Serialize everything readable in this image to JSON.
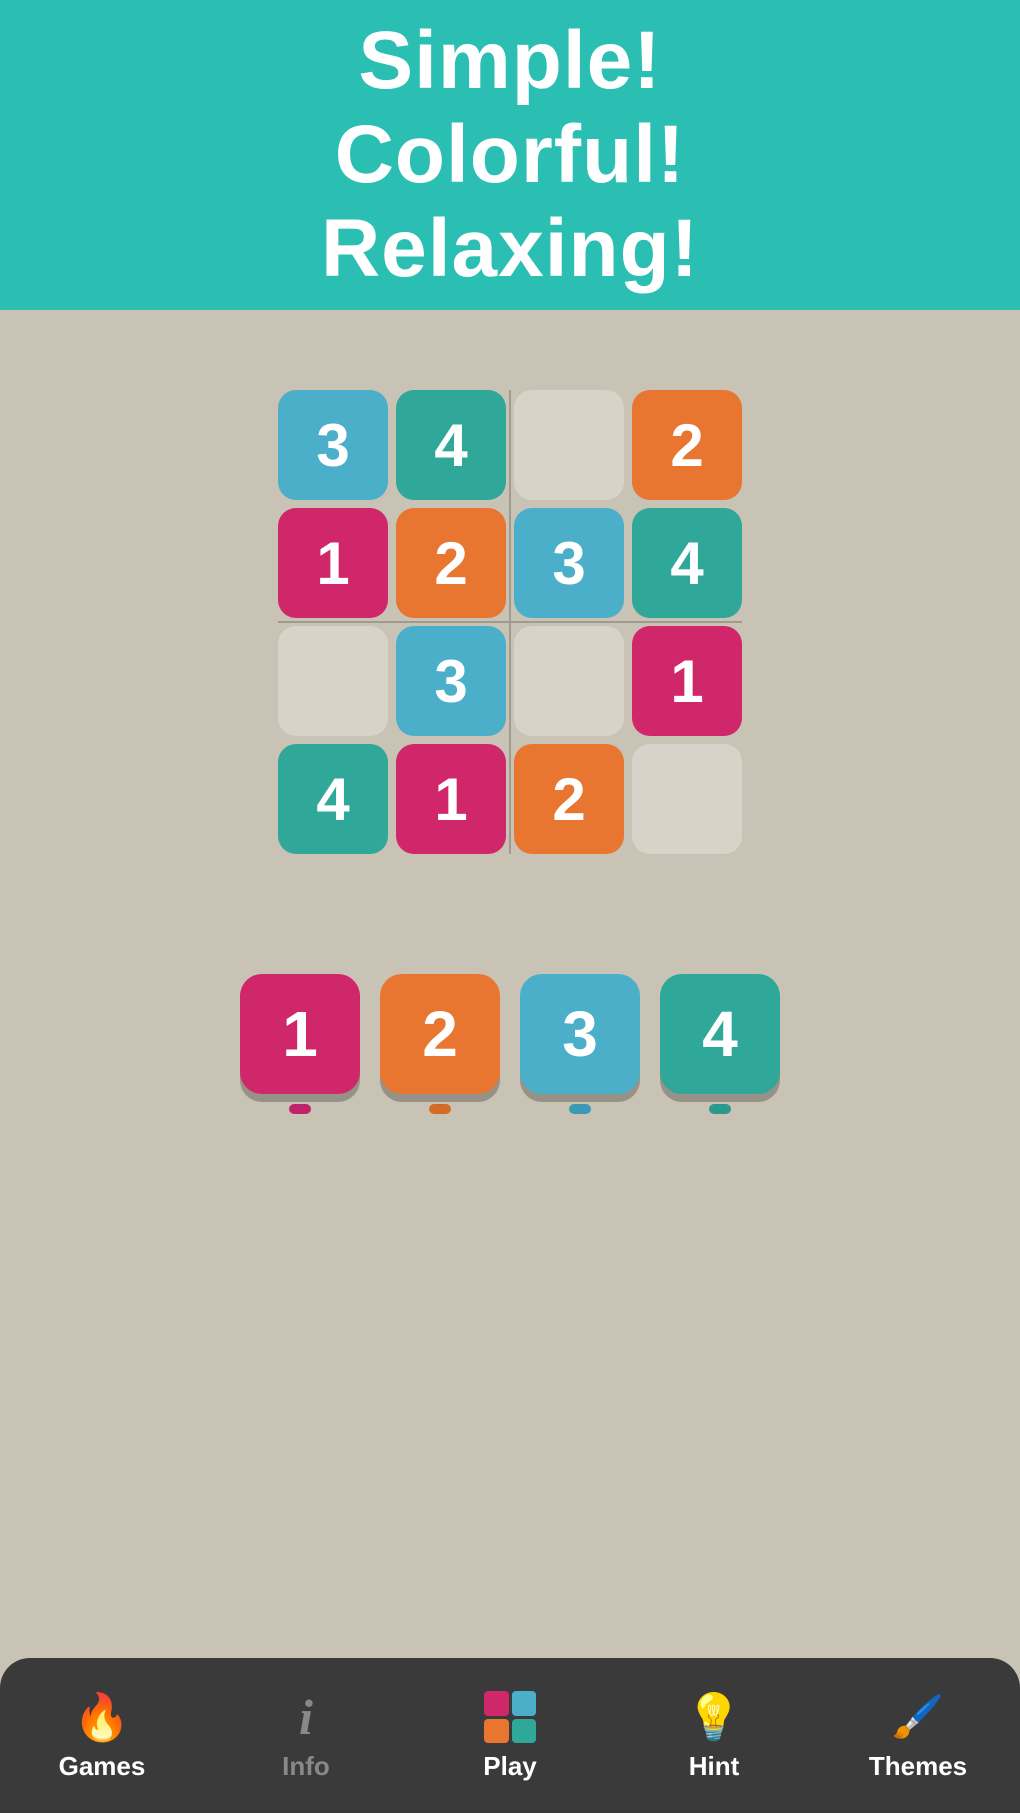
{
  "header": {
    "line1": "Simple!",
    "line2": "Colorful!",
    "line3": "Relaxing!"
  },
  "grid": {
    "cells": [
      {
        "value": "3",
        "type": "blue"
      },
      {
        "value": "4",
        "type": "teal"
      },
      {
        "value": "",
        "type": "empty"
      },
      {
        "value": "2",
        "type": "orange"
      },
      {
        "value": "1",
        "type": "pink"
      },
      {
        "value": "2",
        "type": "orange"
      },
      {
        "value": "3",
        "type": "blue"
      },
      {
        "value": "4",
        "type": "teal"
      },
      {
        "value": "",
        "type": "empty"
      },
      {
        "value": "3",
        "type": "blue"
      },
      {
        "value": "",
        "type": "empty"
      },
      {
        "value": "1",
        "type": "pink"
      },
      {
        "value": "4",
        "type": "teal"
      },
      {
        "value": "1",
        "type": "pink"
      },
      {
        "value": "2",
        "type": "orange"
      },
      {
        "value": "",
        "type": "empty"
      }
    ]
  },
  "tiles": [
    {
      "value": "1",
      "color": "pink",
      "dot": "dot-pink"
    },
    {
      "value": "2",
      "color": "orange",
      "dot": "dot-orange"
    },
    {
      "value": "3",
      "color": "blue",
      "dot": "dot-blue"
    },
    {
      "value": "4",
      "color": "teal",
      "dot": "dot-teal"
    }
  ],
  "nav": {
    "items": [
      {
        "id": "games",
        "label": "Games",
        "dim": false
      },
      {
        "id": "info",
        "label": "Info",
        "dim": true
      },
      {
        "id": "play",
        "label": "Play",
        "dim": false
      },
      {
        "id": "hint",
        "label": "Hint",
        "dim": false
      },
      {
        "id": "themes",
        "label": "Themes",
        "dim": false
      }
    ]
  }
}
